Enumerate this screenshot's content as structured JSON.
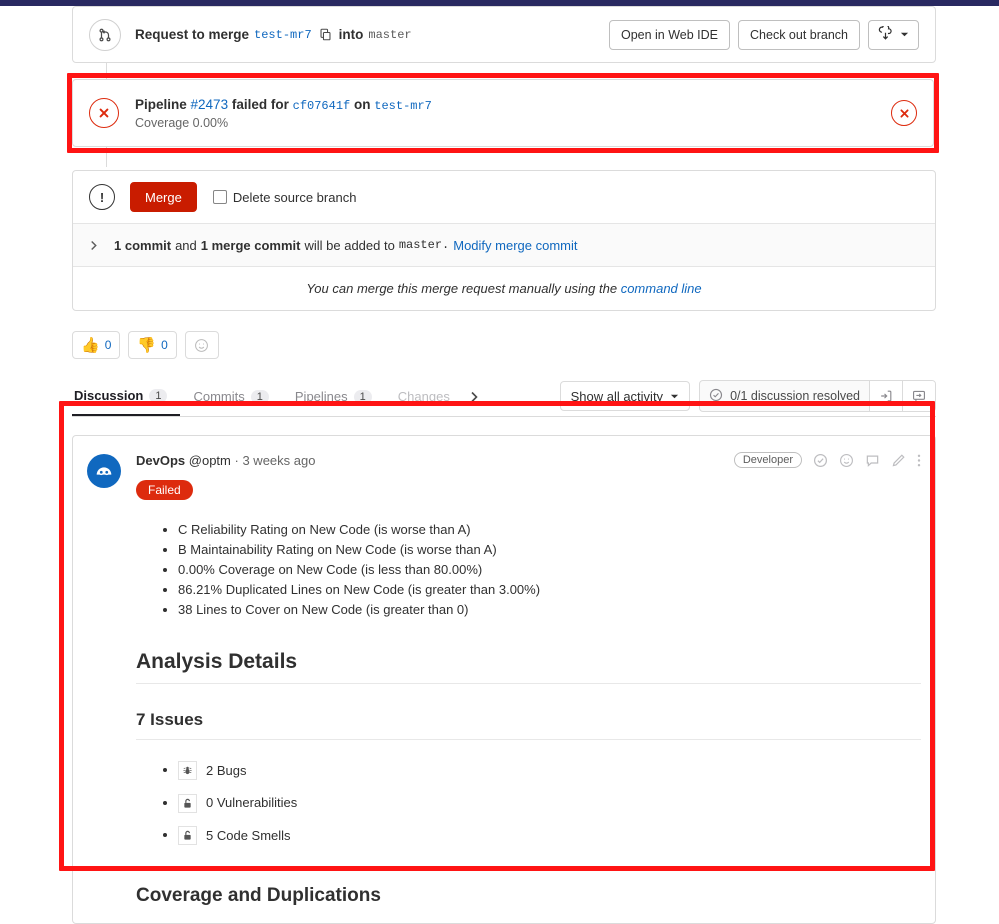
{
  "merge_head": {
    "icon": "merge-request-icon",
    "prefix": "Request to merge",
    "source_branch": "test-mr7",
    "copy_icon": "copy-icon",
    "into": "into",
    "target_branch": "master",
    "buttons": {
      "web_ide": "Open in Web IDE",
      "checkout": "Check out branch",
      "download_icon": "download-icon",
      "caret_icon": "chevron-down-icon"
    }
  },
  "pipeline": {
    "status_icon": "error-circle-icon",
    "label": "Pipeline",
    "id": "#2473",
    "state": "failed for",
    "commit_sha": "cf07641f",
    "on": "on",
    "branch": "test-mr7",
    "coverage": "Coverage 0.00%",
    "dismiss_icon": "error-circle-icon",
    "accent_color": "#dd2b0e"
  },
  "merge_widget": {
    "warn_icon": "warning-circle-icon",
    "merge_button": "Merge",
    "merge_button_color": "#c91c00",
    "delete_branch_label": "Delete source branch",
    "delete_branch_checked": false,
    "commit_row": {
      "chevron_icon": "chevron-right-icon",
      "commit_count": "1 commit",
      "and": "and",
      "merge_commit_count": "1 merge commit",
      "suffix": "will be added to",
      "target": "master.",
      "modify_link": "Modify merge commit"
    },
    "manual_text_prefix": "You can merge this merge request manually using the",
    "manual_link": "command line"
  },
  "awards": [
    {
      "name": "thumbsup",
      "emoji": "👍",
      "count": "0"
    },
    {
      "name": "thumbsdown",
      "emoji": "👎",
      "count": "0"
    }
  ],
  "award_add_icon": "add-reaction-icon",
  "tabs": [
    {
      "label": "Discussion",
      "count": "1",
      "active": true
    },
    {
      "label": "Commits",
      "count": "1",
      "active": false
    },
    {
      "label": "Pipelines",
      "count": "1",
      "active": false
    },
    {
      "label": "Changes",
      "count": "",
      "active": false
    }
  ],
  "tabs_overflow_icon": "chevron-right-icon",
  "tabs_right": {
    "activity_filter": "Show all activity",
    "activity_caret": "chevron-down-icon",
    "resolved_icon": "check-circle-icon",
    "resolved_text": "0/1 discussion resolved",
    "jump_icon": "jump-to-next-discussion-icon",
    "thread_icon": "toggle-comments-icon"
  },
  "note": {
    "avatar": "devops-bot-avatar",
    "author": "DevOps",
    "handle": "@optm",
    "separator": "·",
    "timestamp": "3 weeks ago",
    "role_badge": "Developer",
    "actions": [
      "resolve-thread-icon",
      "add-reaction-icon",
      "reply-icon",
      "edit-icon",
      "more-actions-icon"
    ],
    "status_badge": "Failed",
    "status_badge_color": "#dd2b0e",
    "quality_gate_conditions": [
      "C Reliability Rating on New Code (is worse than A)",
      "B Maintainability Rating on New Code (is worse than A)",
      "0.00% Coverage on New Code (is less than 80.00%)",
      "86.21% Duplicated Lines on New Code (is greater than 3.00%)",
      "38 Lines to Cover on New Code (is greater than 0)"
    ],
    "analysis_heading": "Analysis Details",
    "issues_heading": "7 Issues",
    "issues": [
      {
        "icon": "bug-icon",
        "label": "2 Bugs"
      },
      {
        "icon": "unlock-icon",
        "label": "0 Vulnerabilities"
      },
      {
        "icon": "unlock-icon",
        "label": "5 Code Smells"
      }
    ],
    "coverage_heading": "Coverage and Duplications"
  },
  "annotations": {
    "highlight_color": "#ff1414",
    "regions": [
      "pipeline-widget",
      "discussion-note"
    ]
  }
}
